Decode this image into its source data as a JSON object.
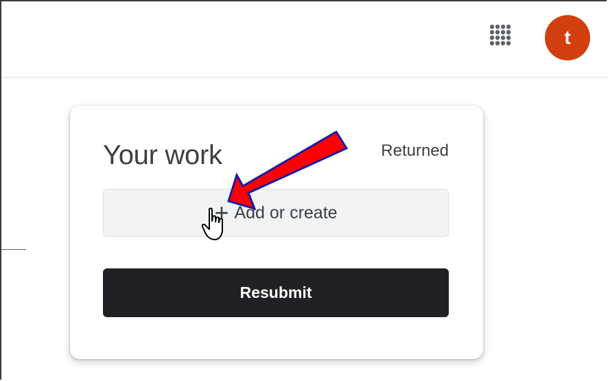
{
  "header": {
    "apps_icon": "apps-grid-icon",
    "avatar_initial": "t",
    "avatar_color": "#d23f0f"
  },
  "work_card": {
    "title": "Your work",
    "status": "Returned",
    "add_button": {
      "icon": "plus-icon",
      "label": "Add or create"
    },
    "resubmit_label": "Resubmit"
  },
  "annotation": {
    "arrow_color": "#ff0000",
    "arrow_outline": "#1a1aa6",
    "cursor_icon": "hand-pointer-icon"
  }
}
